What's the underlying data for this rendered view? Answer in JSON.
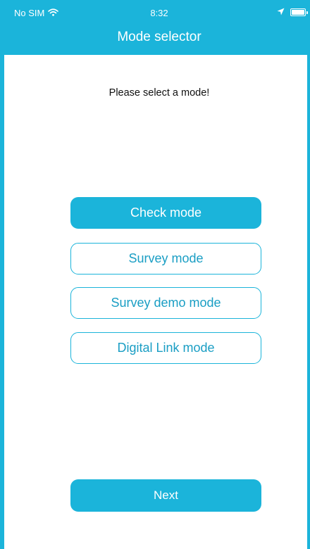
{
  "status_bar": {
    "carrier": "No SIM",
    "time": "8:32",
    "icons": [
      "wifi-icon",
      "location-arrow-icon",
      "battery-icon"
    ]
  },
  "nav": {
    "title": "Mode selector"
  },
  "prompt": "Please select a mode!",
  "modes": [
    {
      "label": "Check mode",
      "selected": true
    },
    {
      "label": "Survey mode",
      "selected": false
    },
    {
      "label": "Survey demo mode",
      "selected": false
    },
    {
      "label": "Digital Link mode",
      "selected": false
    }
  ],
  "next_label": "Next",
  "colors": {
    "accent": "#1bb4da",
    "outline_text": "#1a9ec4",
    "background": "#ffffff"
  }
}
